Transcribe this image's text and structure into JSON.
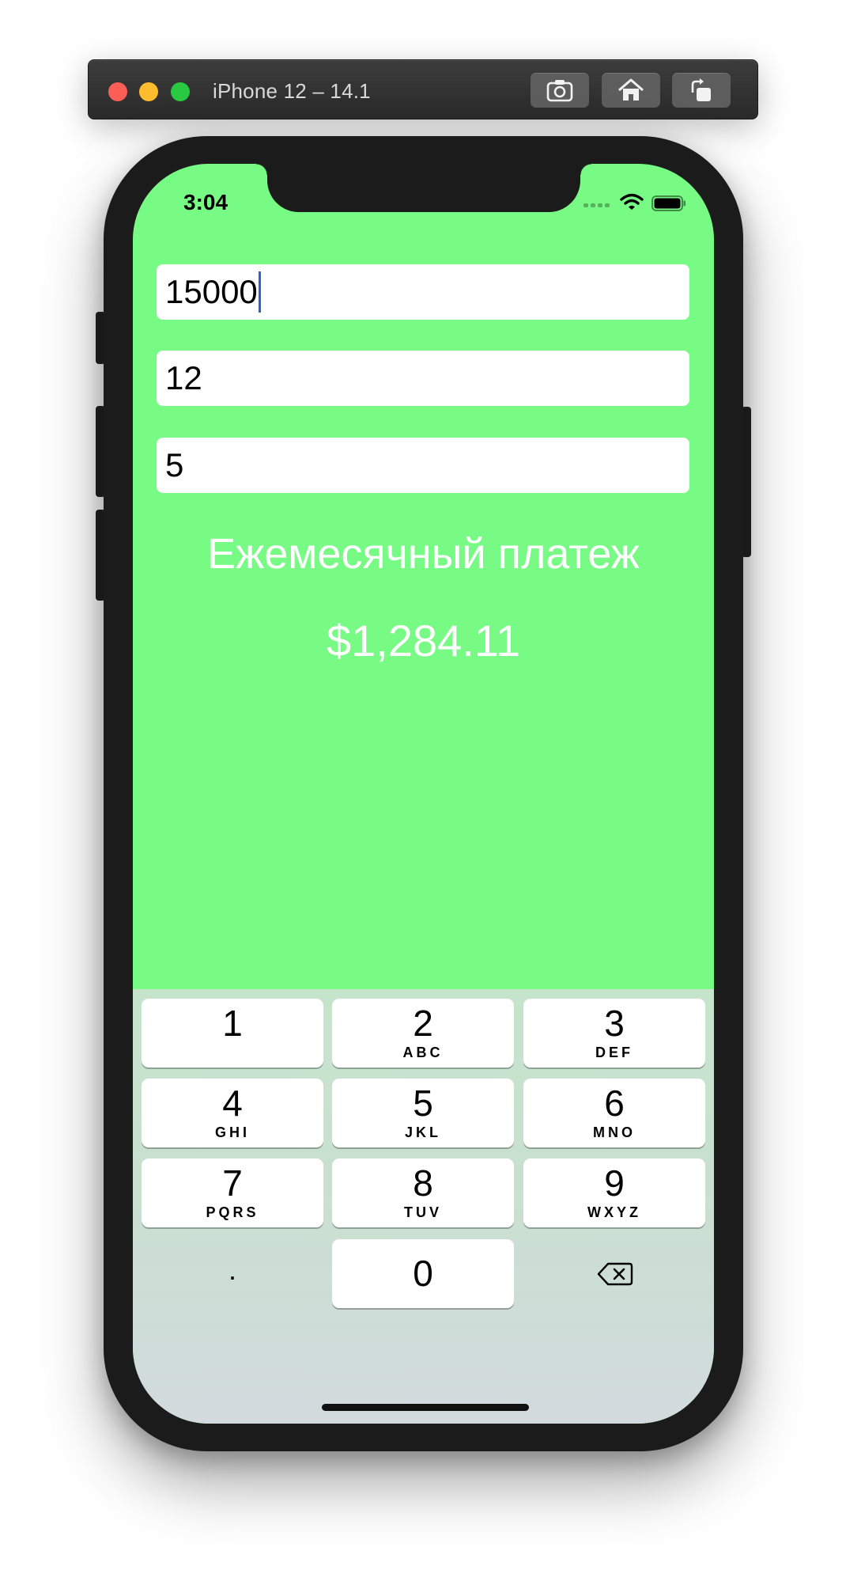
{
  "window": {
    "title": "iPhone 12 – 14.1",
    "toolbar": [
      {
        "icon": "screenshot-icon"
      },
      {
        "icon": "home-icon"
      },
      {
        "icon": "rotate-icon"
      }
    ]
  },
  "status_bar": {
    "time": "3:04",
    "icons": [
      "cellular-dots-icon",
      "wifi-icon",
      "battery-icon"
    ]
  },
  "form": {
    "field_1_value": "15000",
    "field_2_value": "12",
    "field_3_value": "5"
  },
  "result": {
    "title": "Ежемесячный платеж",
    "amount": "$1,284.11"
  },
  "keyboard": {
    "keys": [
      {
        "num": "1",
        "letters": ""
      },
      {
        "num": "2",
        "letters": "ABC"
      },
      {
        "num": "3",
        "letters": "DEF"
      },
      {
        "num": "4",
        "letters": "GHI"
      },
      {
        "num": "5",
        "letters": "JKL"
      },
      {
        "num": "6",
        "letters": "MNO"
      },
      {
        "num": "7",
        "letters": "PQRS"
      },
      {
        "num": "8",
        "letters": "TUV"
      },
      {
        "num": "9",
        "letters": "WXYZ"
      },
      {
        "num": ".",
        "letters": ""
      },
      {
        "num": "0",
        "letters": ""
      },
      {
        "num": "",
        "letters": "",
        "icon": "backspace-icon"
      }
    ]
  },
  "colors": {
    "screen_background": "#78fb84",
    "caret": "#2f5ddc",
    "result_text": "#ffffff"
  }
}
